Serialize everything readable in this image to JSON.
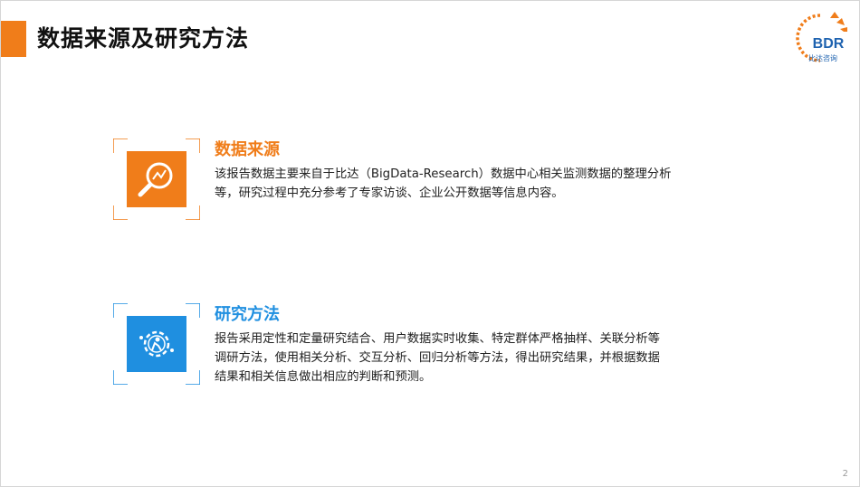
{
  "header": {
    "title": "数据来源及研究方法",
    "logo_text": "BDR",
    "logo_caption": "比达咨询"
  },
  "sections": [
    {
      "title": "数据来源",
      "lines": [
        "该报告数据主要来自于比达（BigData-Research）数据中心相关监测数据的整理分析",
        "等，研究过程中充分参考了专家访谈、企业公开数据等信息内容。"
      ],
      "icon": "magnifier-chart-icon",
      "color": "#f07d1a"
    },
    {
      "title": "研究方法",
      "lines": [
        "报告采用定性和定量研究结合、用户数据实时收集、特定群体严格抽样、关联分析等",
        "调研方法，使用相关分析、交互分析、回归分析等方法，得出研究结果，并根据数据",
        "结果和相关信息做出相应的判断和预测。"
      ],
      "icon": "gear-person-icon",
      "color": "#1f8fe0"
    }
  ],
  "footer": {
    "page_number": "2"
  },
  "colors": {
    "accent": "#f07d1a",
    "blue": "#1f8fe0",
    "logo_blue": "#1f63b0"
  }
}
